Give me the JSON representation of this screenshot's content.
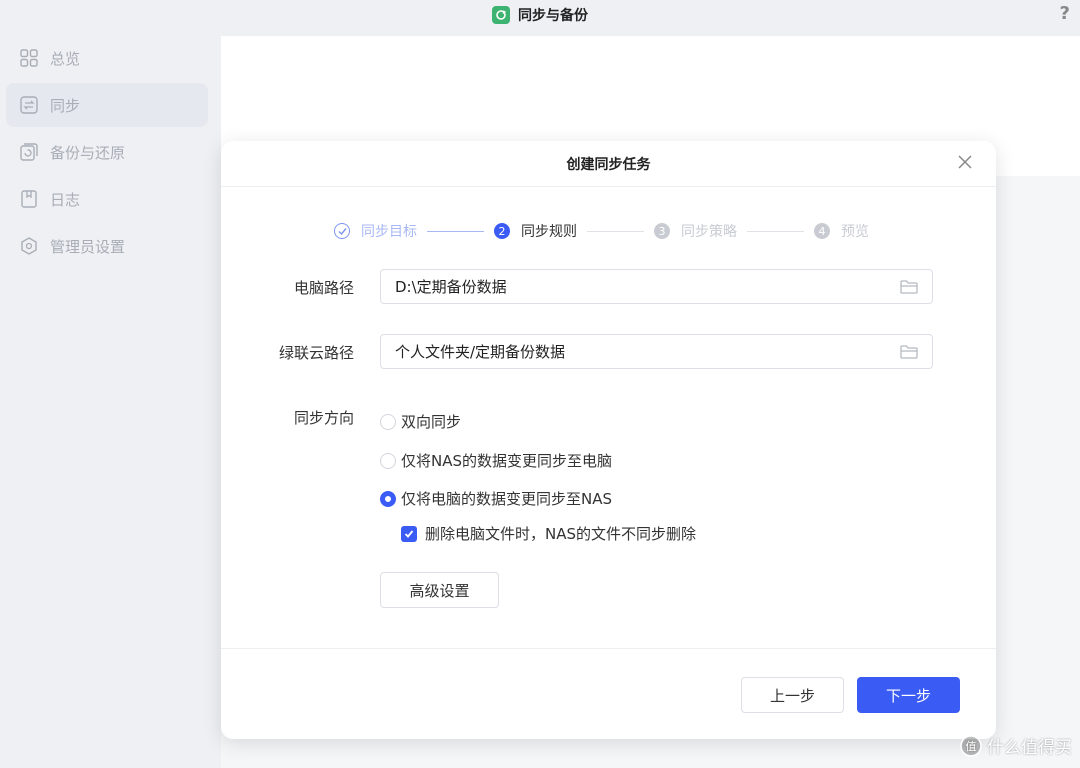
{
  "app": {
    "title": "同步与备份",
    "help_label": "?"
  },
  "sidebar": {
    "items": [
      {
        "label": "总览",
        "icon": "grid-icon",
        "active": false
      },
      {
        "label": "同步",
        "icon": "sync-icon",
        "active": true
      },
      {
        "label": "备份与还原",
        "icon": "backup-icon",
        "active": false
      },
      {
        "label": "日志",
        "icon": "log-icon",
        "active": false
      },
      {
        "label": "管理员设置",
        "icon": "settings-icon",
        "active": false
      }
    ]
  },
  "modal": {
    "title": "创建同步任务",
    "steps": [
      {
        "number": "1",
        "label": "同步目标",
        "state": "done"
      },
      {
        "number": "2",
        "label": "同步规则",
        "state": "current"
      },
      {
        "number": "3",
        "label": "同步策略",
        "state": "pending"
      },
      {
        "number": "4",
        "label": "预览",
        "state": "pending"
      }
    ],
    "pc_path": {
      "label": "电脑路径",
      "value": "D:\\定期备份数据"
    },
    "cloud_path": {
      "label": "绿联云路径",
      "value": "个人文件夹/定期备份数据"
    },
    "direction": {
      "label": "同步方向",
      "options": [
        {
          "label": "双向同步",
          "checked": false
        },
        {
          "label": "仅将NAS的数据变更同步至电脑",
          "checked": false
        },
        {
          "label": "仅将电脑的数据变更同步至NAS",
          "checked": true
        }
      ]
    },
    "delete_option": {
      "label": "删除电脑文件时，NAS的文件不同步删除",
      "checked": true
    },
    "advanced_label": "高级设置",
    "prev_label": "上一步",
    "next_label": "下一步"
  },
  "colors": {
    "accent": "#3b5bf5",
    "sidebar_text": "#a8adb6",
    "step_done": "#a8b8f5",
    "step_pending": "#c8cbd2",
    "app_icon": "#3cb371"
  },
  "watermark": {
    "text": "什么值得买",
    "icon": "zhi-icon"
  }
}
